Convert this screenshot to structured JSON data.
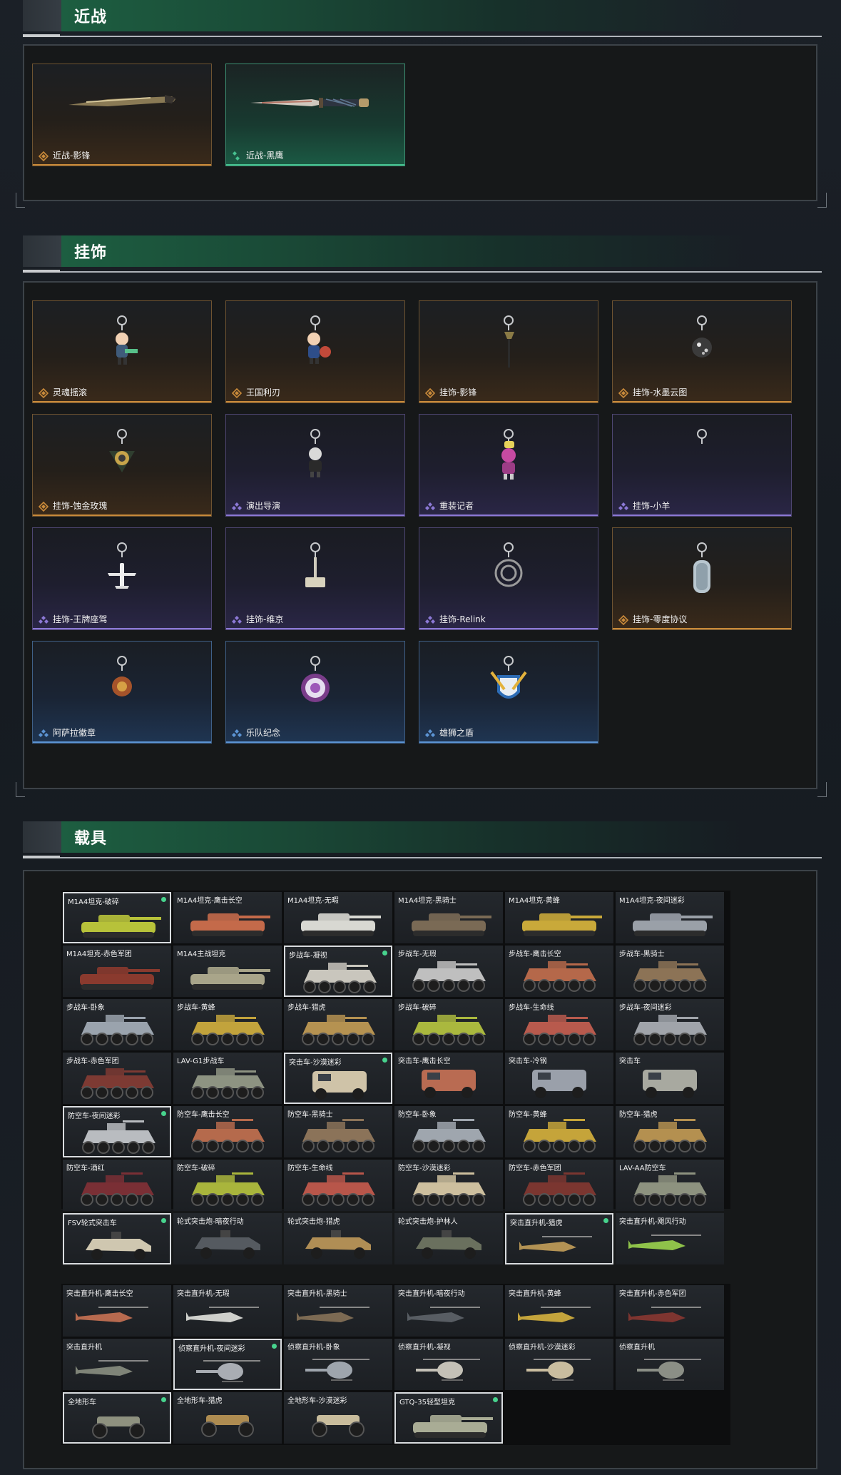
{
  "sections": {
    "melee": {
      "title": "近战",
      "items": [
        {
          "label": "近战-影锋",
          "rarity": "gold"
        },
        {
          "label": "近战-黑鹰",
          "rarity": "green"
        }
      ]
    },
    "charms": {
      "title": "挂饰",
      "items": [
        {
          "label": "灵魂摇滚",
          "rarity": "gold"
        },
        {
          "label": "王国利刃",
          "rarity": "gold"
        },
        {
          "label": "挂饰-影锋",
          "rarity": "gold"
        },
        {
          "label": "挂饰-水墨云图",
          "rarity": "gold"
        },
        {
          "label": "挂饰-蚀金玫瑰",
          "rarity": "gold"
        },
        {
          "label": "演出导演",
          "rarity": "purple"
        },
        {
          "label": "重装记者",
          "rarity": "purple"
        },
        {
          "label": "挂饰-小羊",
          "rarity": "purple"
        },
        {
          "label": "挂饰-王牌座驾",
          "rarity": "purple"
        },
        {
          "label": "挂饰-维京",
          "rarity": "purple"
        },
        {
          "label": "挂饰-Relink",
          "rarity": "purple"
        },
        {
          "label": "挂饰-零度协议",
          "rarity": "gold"
        },
        {
          "label": "阿萨拉徽章",
          "rarity": "blue"
        },
        {
          "label": "乐队纪念",
          "rarity": "blue"
        },
        {
          "label": "雄狮之盾",
          "rarity": "blue"
        }
      ]
    },
    "vehicles": {
      "title": "载具",
      "ground": [
        {
          "label": "M1A4坦克-破碎",
          "type": "tank",
          "selected": true,
          "color": "#b7c23a"
        },
        {
          "label": "M1A4坦克-鹰击长空",
          "type": "tank",
          "selected": false,
          "color": "#c46a4a"
        },
        {
          "label": "M1A4坦克-无暇",
          "type": "tank",
          "selected": false,
          "color": "#d8d8d2"
        },
        {
          "label": "M1A4坦克-黑骑士",
          "type": "tank",
          "selected": false,
          "color": "#7a6a55"
        },
        {
          "label": "M1A4坦克-黄蜂",
          "type": "tank",
          "selected": false,
          "color": "#c9a93a"
        },
        {
          "label": "M1A4坦克-夜间迷彩",
          "type": "tank",
          "selected": false,
          "color": "#9aa0a8"
        },
        {
          "label": "M1A4坦克-赤色军团",
          "type": "tank",
          "selected": false,
          "color": "#8a3a2e"
        },
        {
          "label": "M1A4主战坦克",
          "type": "tank",
          "selected": false,
          "color": "#a9a58a"
        },
        {
          "label": "步战车-凝视",
          "type": "ifv",
          "selected": true,
          "color": "#c9c6bd"
        },
        {
          "label": "步战车-无瑕",
          "type": "ifv",
          "selected": false,
          "color": "#bfbfbf"
        },
        {
          "label": "步战车-鹰击长空",
          "type": "ifv",
          "selected": false,
          "color": "#b5684a"
        },
        {
          "label": "步战车-黑骑士",
          "type": "ifv",
          "selected": false,
          "color": "#8c7356"
        },
        {
          "label": "步战车-卧象",
          "type": "ifv",
          "selected": false,
          "color": "#9aa3ad"
        },
        {
          "label": "步战车-黄蜂",
          "type": "ifv",
          "selected": false,
          "color": "#c2a33c"
        },
        {
          "label": "步战车-猎虎",
          "type": "ifv",
          "selected": false,
          "color": "#b59251"
        },
        {
          "label": "步战车-破碎",
          "type": "ifv",
          "selected": false,
          "color": "#aab83e"
        },
        {
          "label": "步战车-生命线",
          "type": "ifv",
          "selected": false,
          "color": "#b85a4d"
        },
        {
          "label": "步战车-夜间迷彩",
          "type": "ifv",
          "selected": false,
          "color": "#a0a4aa"
        },
        {
          "label": "步战车-赤色军团",
          "type": "ifv",
          "selected": false,
          "color": "#7d3a33"
        },
        {
          "label": "LAV-G1步战车",
          "type": "ifv",
          "selected": false,
          "color": "#8d9382"
        },
        {
          "label": "突击车-沙漠迷彩",
          "type": "truck",
          "selected": true,
          "color": "#cfc3a8"
        },
        {
          "label": "突击车-鹰击长空",
          "type": "truck",
          "selected": false,
          "color": "#b96b52"
        },
        {
          "label": "突击车-冷钢",
          "type": "truck",
          "selected": false,
          "color": "#9aa0aa"
        },
        {
          "label": "突击车",
          "type": "truck",
          "selected": false,
          "color": "#a8a9a0"
        },
        {
          "label": "防空车-夜间迷彩",
          "type": "aa",
          "selected": true,
          "color": "#b9bcc0"
        },
        {
          "label": "防空车-鹰击长空",
          "type": "aa",
          "selected": false,
          "color": "#b56a4c"
        },
        {
          "label": "防空车-黑骑士",
          "type": "aa",
          "selected": false,
          "color": "#8b7359"
        },
        {
          "label": "防空车-卧象",
          "type": "aa",
          "selected": false,
          "color": "#9fa6ae"
        },
        {
          "label": "防空车-黄蜂",
          "type": "aa",
          "selected": false,
          "color": "#c5a43a"
        },
        {
          "label": "防空车-猎虎",
          "type": "aa",
          "selected": false,
          "color": "#b49050"
        },
        {
          "label": "防空车-酒红",
          "type": "aa",
          "selected": false,
          "color": "#7a2f35"
        },
        {
          "label": "防空车-破碎",
          "type": "aa",
          "selected": false,
          "color": "#a9b53c"
        },
        {
          "label": "防空车-生命线",
          "type": "aa",
          "selected": false,
          "color": "#b8564a"
        },
        {
          "label": "防空车-沙漠迷彩",
          "type": "aa",
          "selected": false,
          "color": "#cdbf9e"
        },
        {
          "label": "防空车-赤色军团",
          "type": "aa",
          "selected": false,
          "color": "#7b3630"
        },
        {
          "label": "LAV-AA防空车",
          "type": "aa",
          "selected": false,
          "color": "#8d927f"
        },
        {
          "label": "FSV轮式突击车",
          "type": "jeep",
          "selected": true,
          "color": "#cfc7b0"
        },
        {
          "label": "轮式突击炮-暗夜行动",
          "type": "jeep",
          "selected": false,
          "color": "#555a60"
        },
        {
          "label": "轮式突击炮-猎虎",
          "type": "jeep",
          "selected": false,
          "color": "#b08e55"
        },
        {
          "label": "轮式突击炮-护林人",
          "type": "jeep",
          "selected": false,
          "color": "#6a705e"
        },
        {
          "label": "突击直升机-猎虎",
          "type": "heli",
          "selected": true,
          "color": "#b39254"
        },
        {
          "label": "突击直升机-飓风行动",
          "type": "heli",
          "selected": false,
          "color": "#8fc24a"
        }
      ],
      "air": [
        {
          "label": "突击直升机-鹰击长空",
          "type": "heli",
          "selected": false,
          "color": "#b76a4f"
        },
        {
          "label": "突击直升机-无瑕",
          "type": "heli",
          "selected": false,
          "color": "#cfd0cc"
        },
        {
          "label": "突击直升机-黑骑士",
          "type": "heli",
          "selected": false,
          "color": "#7c6a53"
        },
        {
          "label": "突击直升机-暗夜行动",
          "type": "heli",
          "selected": false,
          "color": "#585d63"
        },
        {
          "label": "突击直升机-黄蜂",
          "type": "heli",
          "selected": false,
          "color": "#c4a43c"
        },
        {
          "label": "突击直升机-赤色军团",
          "type": "heli",
          "selected": false,
          "color": "#7e3530"
        },
        {
          "label": "突击直升机",
          "type": "heli",
          "selected": false,
          "color": "#7f8478"
        },
        {
          "label": "侦察直升机-夜间迷彩",
          "type": "scout",
          "selected": true,
          "color": "#a9adb3"
        },
        {
          "label": "侦察直升机-卧象",
          "type": "scout",
          "selected": false,
          "color": "#9ea5ad"
        },
        {
          "label": "侦察直升机-凝视",
          "type": "scout",
          "selected": false,
          "color": "#c4c1b7"
        },
        {
          "label": "侦察直升机-沙漠迷彩",
          "type": "scout",
          "selected": false,
          "color": "#c9bd9f"
        },
        {
          "label": "侦察直升机",
          "type": "scout",
          "selected": false,
          "color": "#8b8f86"
        },
        {
          "label": "全地形车",
          "type": "atv",
          "selected": true,
          "color": "#8e917f"
        },
        {
          "label": "全地形车-猎虎",
          "type": "atv",
          "selected": false,
          "color": "#ae8c51"
        },
        {
          "label": "全地形车-沙漠迷彩",
          "type": "atv",
          "selected": false,
          "color": "#c8bc9c"
        },
        {
          "label": "GTQ-35轻型坦克",
          "type": "tank",
          "selected": true,
          "color": "#a9ac95"
        }
      ]
    }
  },
  "colors": {
    "gold": "#c98a3a",
    "green": "#46c08f",
    "purple": "#8c79d6",
    "blue": "#5c94d4",
    "selected_dot": "#47d38d"
  }
}
